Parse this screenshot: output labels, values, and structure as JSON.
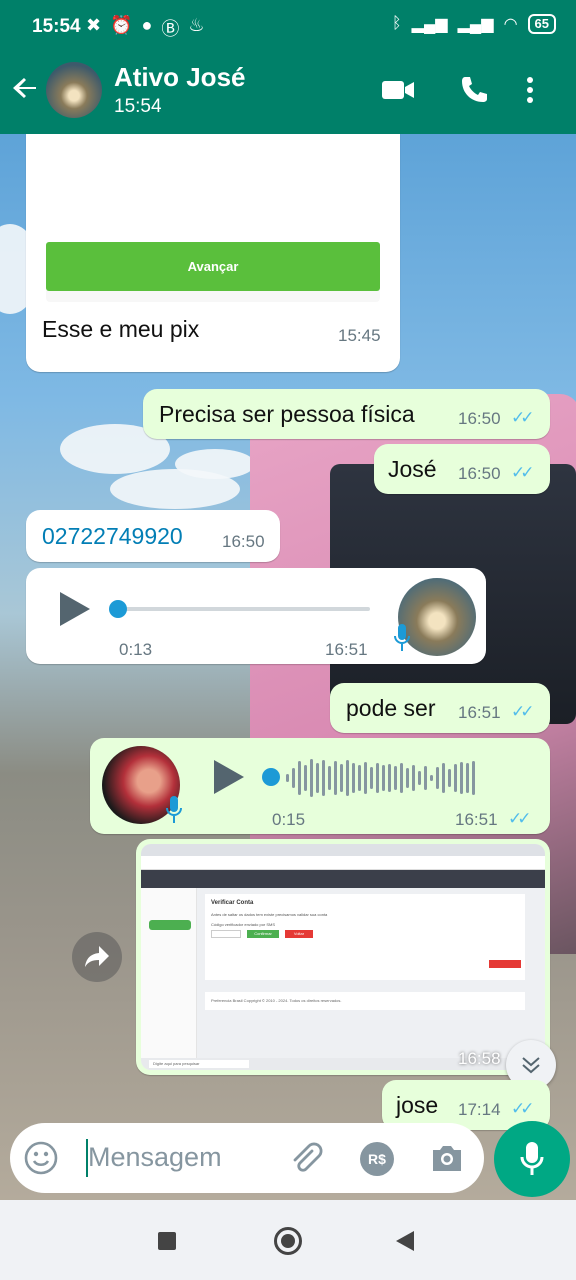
{
  "status_bar": {
    "time": "15:54",
    "battery": "65"
  },
  "header": {
    "contact_name": "Ativo José",
    "subtitle": "15:54"
  },
  "messages": {
    "m1": {
      "button_label": "Avançar",
      "text": "Esse e meu pix",
      "time": "15:45"
    },
    "m2": {
      "text": "Precisa ser pessoa física",
      "time": "16:50"
    },
    "m3": {
      "text": "José",
      "time": "16:50"
    },
    "m4": {
      "text": "02722749920",
      "time": "16:50"
    },
    "m5": {
      "duration": "0:13",
      "time": "16:51"
    },
    "m6": {
      "text": "pode ser",
      "time": "16:51"
    },
    "m7": {
      "duration": "0:15",
      "time": "16:51"
    },
    "m8": {
      "time": "16:58"
    },
    "m9": {
      "text": "jose",
      "time": "17:14"
    }
  },
  "screenshot_content": {
    "title": "Verificar Conta",
    "desc": "Antes de saltar os dados tem existe precisamos validar sua conta",
    "field_label": "Código verificador enviado por SMS",
    "confirm": "Confirmar",
    "cancel": "Voltar",
    "footer": "Preferencia Brasil Copyright © 2010 - 2024. Todos os direitos reservados.",
    "taskbar_search": "Digite aqui para pesquisar"
  },
  "composer": {
    "placeholder": "Mensagem",
    "currency_label": "R$"
  },
  "colors": {
    "header": "#008069",
    "outgoing": "#e7ffdb",
    "incoming": "#ffffff",
    "accent": "#00a884",
    "read_ticks": "#53bdeb"
  },
  "icons": [
    "back-arrow-icon",
    "video-call-icon",
    "phone-icon",
    "more-vert-icon",
    "play-icon",
    "mic-icon",
    "forward-icon",
    "scroll-down-icon",
    "emoji-icon",
    "attach-icon",
    "camera-icon",
    "nav-stop-icon",
    "nav-home-icon",
    "nav-back-icon"
  ]
}
